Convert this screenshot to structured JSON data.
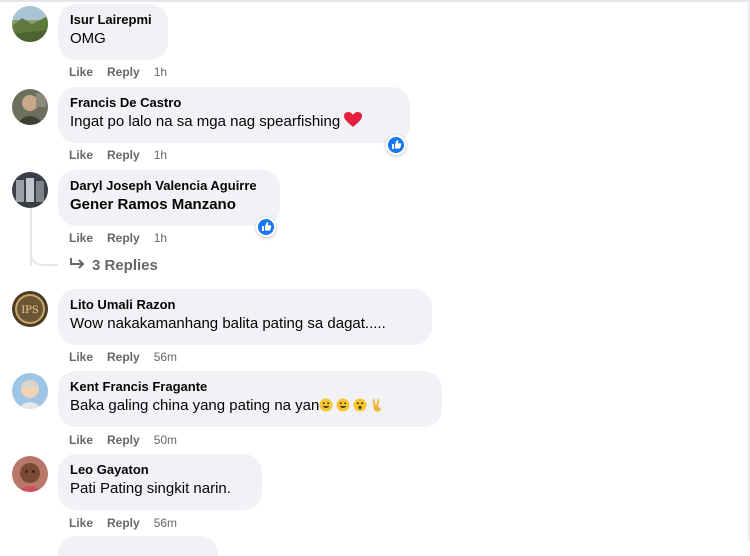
{
  "comments": [
    {
      "author": "Isur Lairepmi",
      "text": "OMG",
      "like": "Like",
      "reply": "Reply",
      "time": "1h"
    },
    {
      "author": "Francis De Castro",
      "text": "Ingat po lalo na sa mga nag spearfishing ",
      "like": "Like",
      "reply": "Reply",
      "time": "1h",
      "reaction": "like-reaction-icon"
    },
    {
      "author": "Daryl Joseph Valencia Aguirre",
      "text": "Gener Ramos Manzano",
      "like": "Like",
      "reply": "Reply",
      "time": "1h",
      "reaction": "like-reaction-icon"
    },
    {
      "author": "Lito Umali Razon",
      "text": "Wow nakakamanhang balita pating sa dagat.....",
      "like": "Like",
      "reply": "Reply",
      "time": "56m"
    },
    {
      "author": "Kent Francis Fragante",
      "text": "Baka galing china yang pating na yan",
      "like": "Like",
      "reply": "Reply",
      "time": "50m"
    },
    {
      "author": "Leo Gayaton",
      "text": "Pati Pating singkit narin.",
      "like": "Like",
      "reply": "Reply",
      "time": "56m"
    }
  ],
  "replies_link": "3 Replies",
  "colors": {
    "bubble": "#f0f2f5",
    "meta": "#65676b",
    "like_blue": "#1877f2",
    "heart": "#e41e3f"
  }
}
